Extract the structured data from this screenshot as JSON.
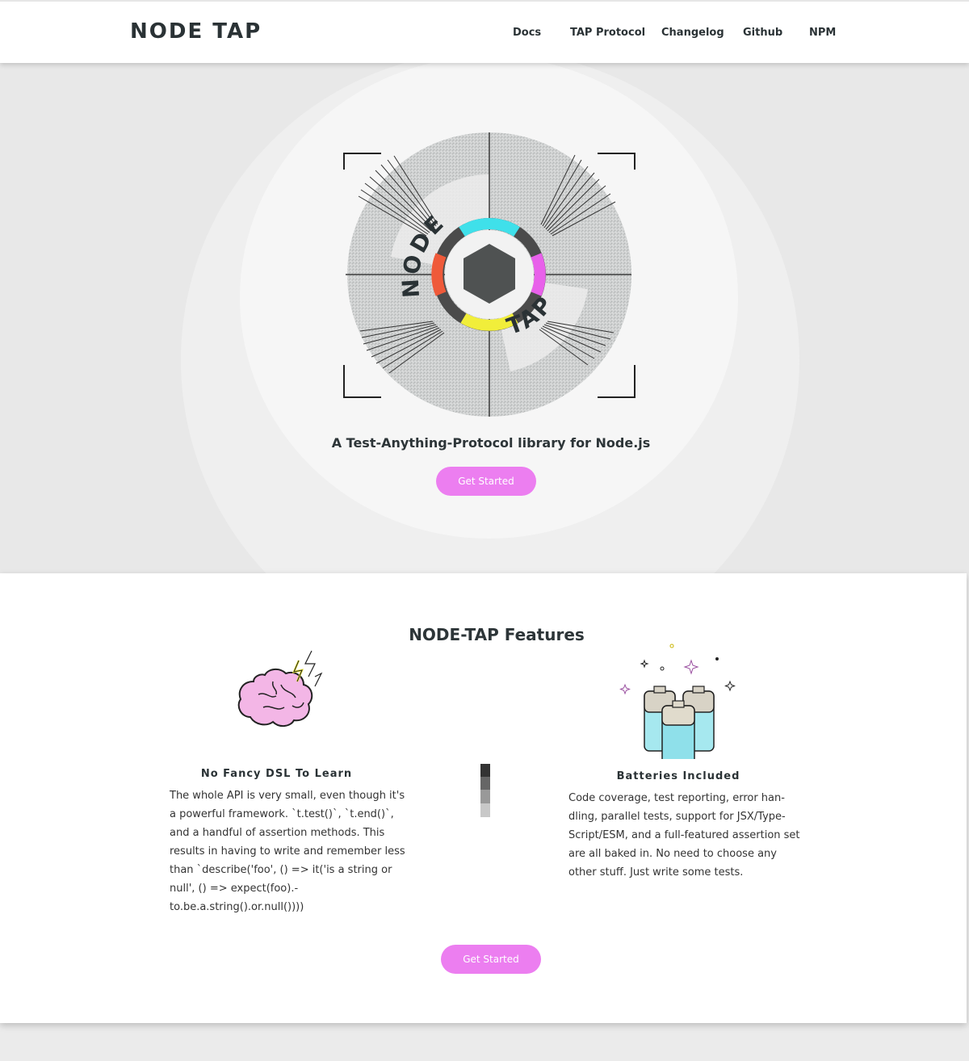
{
  "header": {
    "brand": "NODE TAP",
    "nav": [
      {
        "label": "Docs"
      },
      {
        "label": "TAP Protocol"
      },
      {
        "label": "Changelog"
      },
      {
        "label": "Github"
      },
      {
        "label": "NPM"
      }
    ]
  },
  "hero": {
    "logo_words": {
      "top": "NODE",
      "bottom": "TAP"
    },
    "tagline": "A Test-Anything-Protocol library for Node.js",
    "cta_label": "Get Started"
  },
  "features": {
    "title": "NODE-TAP Features",
    "items": [
      {
        "icon": "brain-icon",
        "heading": "No Fancy DSL To Learn",
        "text": "The whole API is very small, even though it's\na powerful framework.  `t.test()`, `t.end()`,\nand a handful of assertion methods.  This\nresults in having to write and remember less\nthan `describe('foo', () => it('is a string or\nnull', () => expect(foo).-\nto.be.a.string().or.null())))"
      },
      {
        "icon": "batteries-icon",
        "heading": "Batteries Included",
        "text": "Code coverage, test reporting, error han-\ndling, parallel tests, support for JSX/Type-\nScript/ESM, and a full-featured assertion set\nare all baked in.  No need to choose any\nother stuff.  Just write some tests."
      }
    ],
    "cta_label": "Get Started"
  },
  "colors": {
    "accent": "#ec7ef0",
    "text_dark": "#2a3235",
    "ring_cyan": "#3fe0ea",
    "ring_magenta": "#e860ea",
    "ring_yellow": "#f1ee3a",
    "ring_red": "#ef5a3a"
  }
}
